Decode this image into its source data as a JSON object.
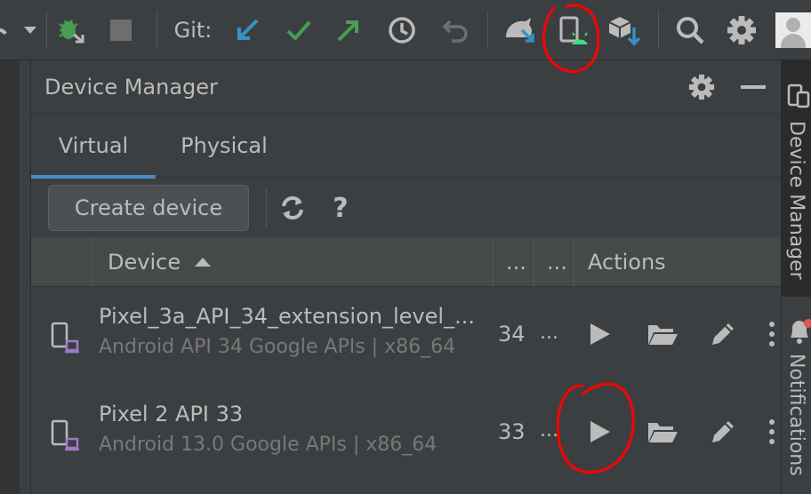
{
  "toolbar": {
    "git_label": "Git:",
    "icons": [
      "dropdown-icon",
      "debug-attach-icon",
      "stop-icon",
      "git-update-icon",
      "git-commit-icon",
      "git-push-icon",
      "history-icon",
      "rollback-icon",
      "sdk-manager-icon",
      "device-manager-icon",
      "sync-project-icon",
      "search-icon",
      "settings-icon",
      "avatar"
    ]
  },
  "panel": {
    "title": "Device Manager",
    "tabs": [
      {
        "label": "Virtual",
        "active": true
      },
      {
        "label": "Physical",
        "active": false
      }
    ],
    "create_button": "Create device",
    "help": "?",
    "table": {
      "headers": {
        "device": "Device",
        "col_api": "...",
        "col_size": "...",
        "actions": "Actions"
      },
      "rows": [
        {
          "name": "Pixel_3a_API_34_extension_level_...",
          "subtitle": "Android API 34 Google APIs | x86_64",
          "api": "34",
          "size": "..."
        },
        {
          "name": "Pixel 2 API 33",
          "subtitle": "Android 13.0 Google APIs | x86_64",
          "api": "33",
          "size": "..."
        }
      ]
    }
  },
  "right_strip": {
    "device_manager_label": "Device Manager",
    "notifications_label": "Notifications"
  },
  "colors": {
    "accent": "#4a88c7",
    "annotation": "#ff0000",
    "android_green": "#3ddc84"
  }
}
